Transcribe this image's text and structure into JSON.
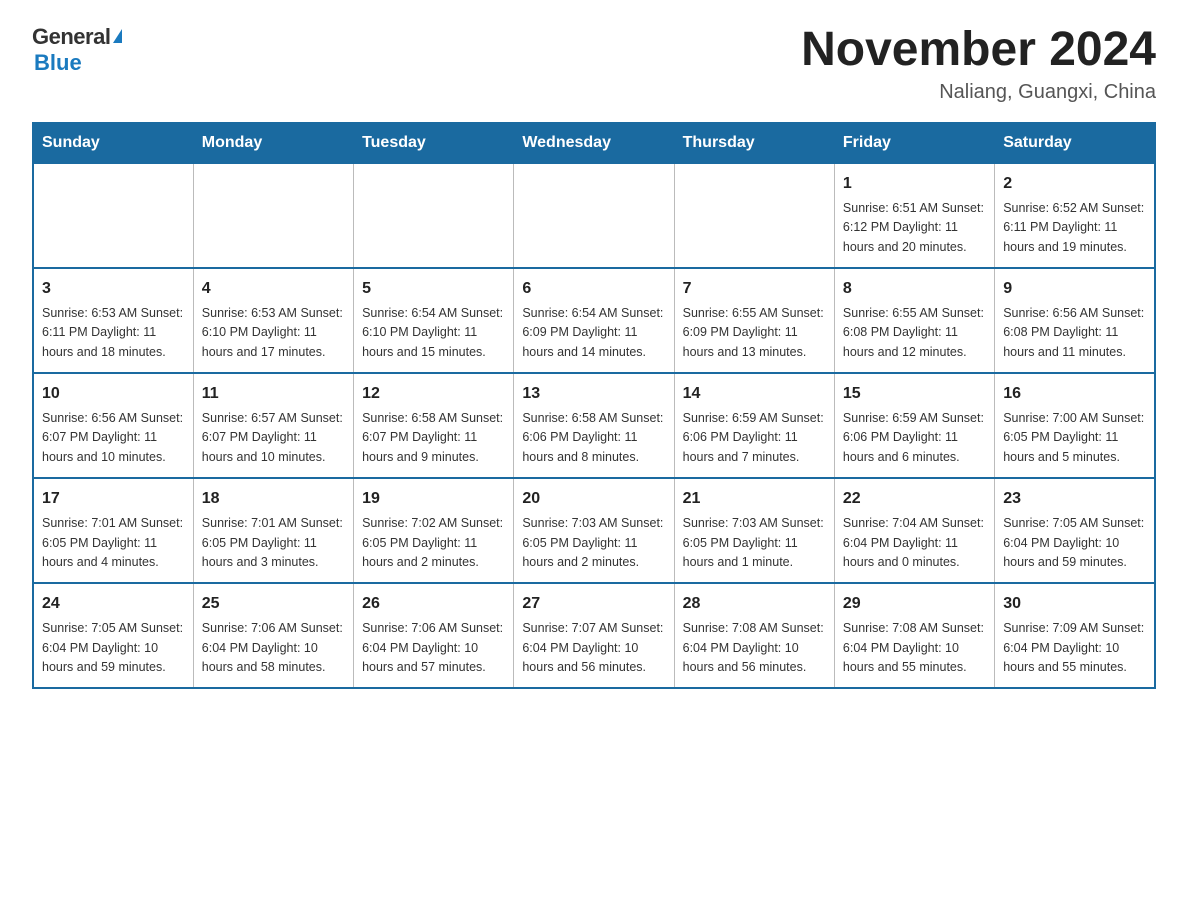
{
  "logo": {
    "general": "General",
    "triangle": "▶",
    "blue": "Blue"
  },
  "title": "November 2024",
  "location": "Naliang, Guangxi, China",
  "days_header": [
    "Sunday",
    "Monday",
    "Tuesday",
    "Wednesday",
    "Thursday",
    "Friday",
    "Saturday"
  ],
  "weeks": [
    [
      {
        "day": "",
        "info": ""
      },
      {
        "day": "",
        "info": ""
      },
      {
        "day": "",
        "info": ""
      },
      {
        "day": "",
        "info": ""
      },
      {
        "day": "",
        "info": ""
      },
      {
        "day": "1",
        "info": "Sunrise: 6:51 AM\nSunset: 6:12 PM\nDaylight: 11 hours\nand 20 minutes."
      },
      {
        "day": "2",
        "info": "Sunrise: 6:52 AM\nSunset: 6:11 PM\nDaylight: 11 hours\nand 19 minutes."
      }
    ],
    [
      {
        "day": "3",
        "info": "Sunrise: 6:53 AM\nSunset: 6:11 PM\nDaylight: 11 hours\nand 18 minutes."
      },
      {
        "day": "4",
        "info": "Sunrise: 6:53 AM\nSunset: 6:10 PM\nDaylight: 11 hours\nand 17 minutes."
      },
      {
        "day": "5",
        "info": "Sunrise: 6:54 AM\nSunset: 6:10 PM\nDaylight: 11 hours\nand 15 minutes."
      },
      {
        "day": "6",
        "info": "Sunrise: 6:54 AM\nSunset: 6:09 PM\nDaylight: 11 hours\nand 14 minutes."
      },
      {
        "day": "7",
        "info": "Sunrise: 6:55 AM\nSunset: 6:09 PM\nDaylight: 11 hours\nand 13 minutes."
      },
      {
        "day": "8",
        "info": "Sunrise: 6:55 AM\nSunset: 6:08 PM\nDaylight: 11 hours\nand 12 minutes."
      },
      {
        "day": "9",
        "info": "Sunrise: 6:56 AM\nSunset: 6:08 PM\nDaylight: 11 hours\nand 11 minutes."
      }
    ],
    [
      {
        "day": "10",
        "info": "Sunrise: 6:56 AM\nSunset: 6:07 PM\nDaylight: 11 hours\nand 10 minutes."
      },
      {
        "day": "11",
        "info": "Sunrise: 6:57 AM\nSunset: 6:07 PM\nDaylight: 11 hours\nand 10 minutes."
      },
      {
        "day": "12",
        "info": "Sunrise: 6:58 AM\nSunset: 6:07 PM\nDaylight: 11 hours\nand 9 minutes."
      },
      {
        "day": "13",
        "info": "Sunrise: 6:58 AM\nSunset: 6:06 PM\nDaylight: 11 hours\nand 8 minutes."
      },
      {
        "day": "14",
        "info": "Sunrise: 6:59 AM\nSunset: 6:06 PM\nDaylight: 11 hours\nand 7 minutes."
      },
      {
        "day": "15",
        "info": "Sunrise: 6:59 AM\nSunset: 6:06 PM\nDaylight: 11 hours\nand 6 minutes."
      },
      {
        "day": "16",
        "info": "Sunrise: 7:00 AM\nSunset: 6:05 PM\nDaylight: 11 hours\nand 5 minutes."
      }
    ],
    [
      {
        "day": "17",
        "info": "Sunrise: 7:01 AM\nSunset: 6:05 PM\nDaylight: 11 hours\nand 4 minutes."
      },
      {
        "day": "18",
        "info": "Sunrise: 7:01 AM\nSunset: 6:05 PM\nDaylight: 11 hours\nand 3 minutes."
      },
      {
        "day": "19",
        "info": "Sunrise: 7:02 AM\nSunset: 6:05 PM\nDaylight: 11 hours\nand 2 minutes."
      },
      {
        "day": "20",
        "info": "Sunrise: 7:03 AM\nSunset: 6:05 PM\nDaylight: 11 hours\nand 2 minutes."
      },
      {
        "day": "21",
        "info": "Sunrise: 7:03 AM\nSunset: 6:05 PM\nDaylight: 11 hours\nand 1 minute."
      },
      {
        "day": "22",
        "info": "Sunrise: 7:04 AM\nSunset: 6:04 PM\nDaylight: 11 hours\nand 0 minutes."
      },
      {
        "day": "23",
        "info": "Sunrise: 7:05 AM\nSunset: 6:04 PM\nDaylight: 10 hours\nand 59 minutes."
      }
    ],
    [
      {
        "day": "24",
        "info": "Sunrise: 7:05 AM\nSunset: 6:04 PM\nDaylight: 10 hours\nand 59 minutes."
      },
      {
        "day": "25",
        "info": "Sunrise: 7:06 AM\nSunset: 6:04 PM\nDaylight: 10 hours\nand 58 minutes."
      },
      {
        "day": "26",
        "info": "Sunrise: 7:06 AM\nSunset: 6:04 PM\nDaylight: 10 hours\nand 57 minutes."
      },
      {
        "day": "27",
        "info": "Sunrise: 7:07 AM\nSunset: 6:04 PM\nDaylight: 10 hours\nand 56 minutes."
      },
      {
        "day": "28",
        "info": "Sunrise: 7:08 AM\nSunset: 6:04 PM\nDaylight: 10 hours\nand 56 minutes."
      },
      {
        "day": "29",
        "info": "Sunrise: 7:08 AM\nSunset: 6:04 PM\nDaylight: 10 hours\nand 55 minutes."
      },
      {
        "day": "30",
        "info": "Sunrise: 7:09 AM\nSunset: 6:04 PM\nDaylight: 10 hours\nand 55 minutes."
      }
    ]
  ]
}
